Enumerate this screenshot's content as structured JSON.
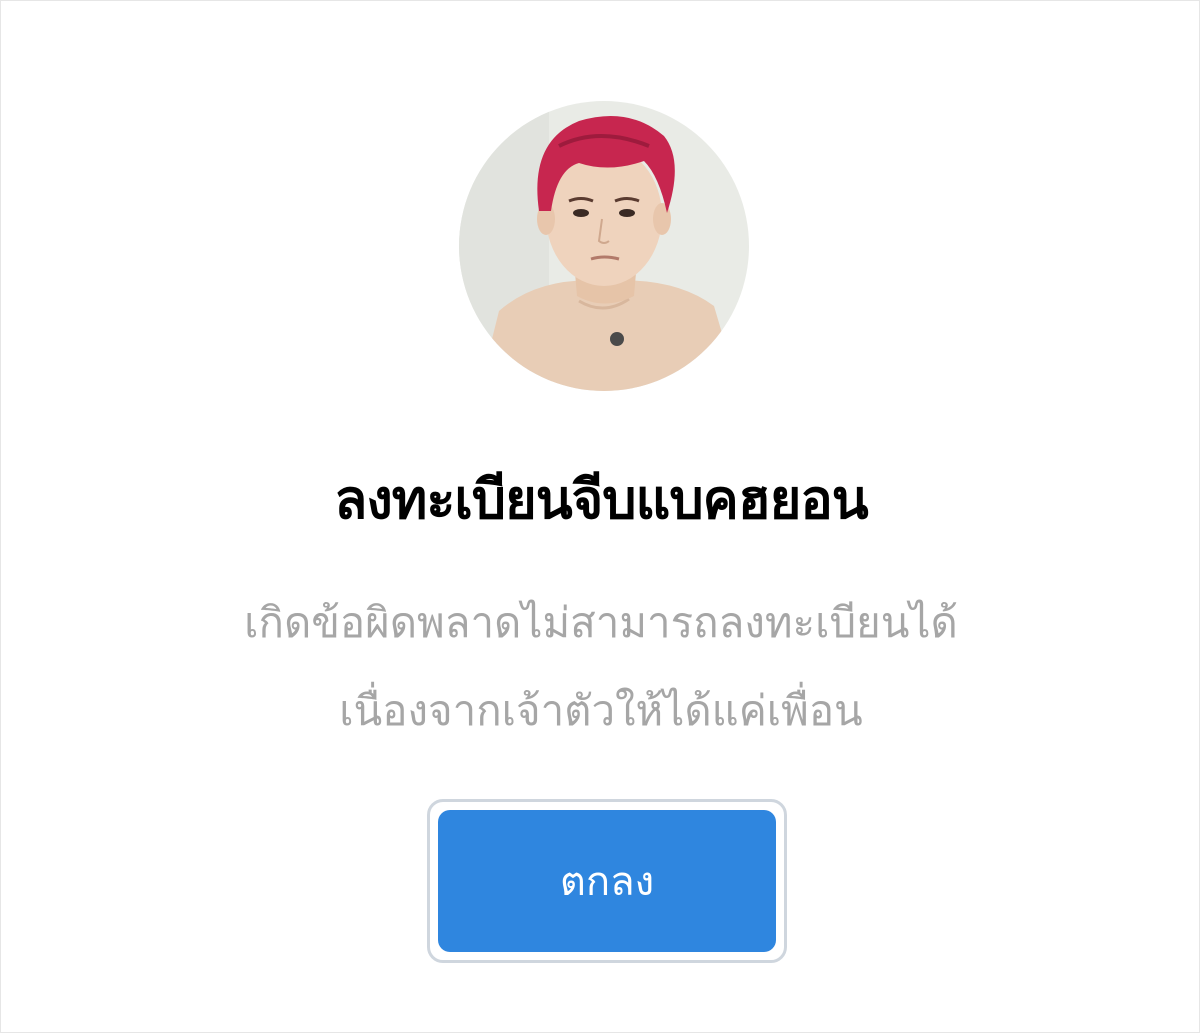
{
  "dialog": {
    "avatar_icon": "profile-photo",
    "title": "ลงทะเบียนจีบแบคฮยอน",
    "message_lines": [
      "เกิดข้อผิดพลาดไม่สามารถลงทะเบียนได้",
      "เนื่องจากเจ้าตัวให้ได้แค่เพื่อน"
    ],
    "ok_label": "ตกลง"
  },
  "colors": {
    "button": "#2f86df",
    "message_text": "#a6a6a6",
    "title_text": "#000000"
  }
}
